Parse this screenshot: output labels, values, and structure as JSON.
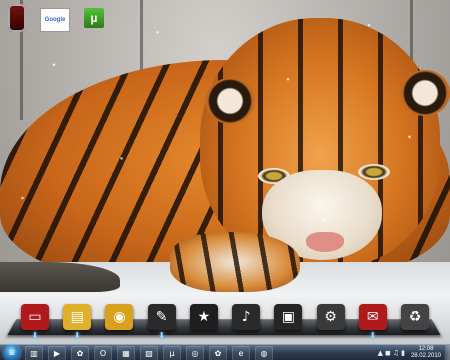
{
  "desktop": {
    "icons": [
      {
        "name": "phone-icon",
        "label": ""
      },
      {
        "name": "google-shortcut",
        "label": "Google"
      },
      {
        "name": "utorrent-shortcut",
        "label": "µ"
      }
    ]
  },
  "dock": {
    "items": [
      {
        "name": "dock-item-monitor",
        "icon": "monitor-icon",
        "glyph": "▭",
        "color": "#b01a1a",
        "running": true
      },
      {
        "name": "dock-item-folder",
        "icon": "folder-icon",
        "glyph": "▤",
        "color": "#e0b02a",
        "running": true
      },
      {
        "name": "dock-item-disk",
        "icon": "hard-disk-icon",
        "glyph": "◉",
        "color": "#d8a21e",
        "running": false
      },
      {
        "name": "dock-item-notes",
        "icon": "notes-icon",
        "glyph": "✎",
        "color": "#2a2a2a",
        "running": true
      },
      {
        "name": "dock-item-star",
        "icon": "star-icon",
        "glyph": "★",
        "color": "#1e1e1e",
        "running": false
      },
      {
        "name": "dock-item-media",
        "icon": "media-icon",
        "glyph": "♪",
        "color": "#2a2a2a",
        "running": false
      },
      {
        "name": "dock-item-device",
        "icon": "device-icon",
        "glyph": "▣",
        "color": "#262626",
        "running": false
      },
      {
        "name": "dock-item-tools",
        "icon": "tools-icon",
        "glyph": "⚙",
        "color": "#3a3a3a",
        "running": false
      },
      {
        "name": "dock-item-mail",
        "icon": "mail-icon",
        "glyph": "✉",
        "color": "#b01a1a",
        "running": true
      },
      {
        "name": "dock-item-trash",
        "icon": "trash-icon",
        "glyph": "♻",
        "color": "#444444",
        "running": false
      }
    ]
  },
  "taskbar": {
    "buttons": [
      {
        "name": "taskbar-explorer",
        "icon": "explorer-icon",
        "glyph": "▥"
      },
      {
        "name": "taskbar-media-player",
        "icon": "media-player-icon",
        "glyph": "▶"
      },
      {
        "name": "taskbar-app-green",
        "icon": "flower-icon",
        "glyph": "✿"
      },
      {
        "name": "taskbar-opera",
        "icon": "opera-icon",
        "glyph": "O"
      },
      {
        "name": "taskbar-app-blue",
        "icon": "window-icon",
        "glyph": "▦"
      },
      {
        "name": "taskbar-app-blue2",
        "icon": "window-icon",
        "glyph": "▧"
      },
      {
        "name": "taskbar-utorrent",
        "icon": "utorrent-icon",
        "glyph": "µ"
      },
      {
        "name": "taskbar-app-red",
        "icon": "circle-icon",
        "glyph": "◎"
      },
      {
        "name": "taskbar-app-flower",
        "icon": "flower-icon",
        "glyph": "✿"
      },
      {
        "name": "taskbar-ie",
        "icon": "browser-icon",
        "glyph": "e"
      },
      {
        "name": "taskbar-app-globe",
        "icon": "globe-icon",
        "glyph": "◍"
      }
    ],
    "tray": {
      "glyphs": [
        "▲",
        "◼",
        "♫",
        "▮"
      ],
      "time": "12:08",
      "date": "28.02.2010"
    }
  },
  "colors": {
    "taskbar_top": "#5c6e86",
    "taskbar_bottom": "#1e2a3b",
    "tiger_orange": "#e58a2c"
  }
}
